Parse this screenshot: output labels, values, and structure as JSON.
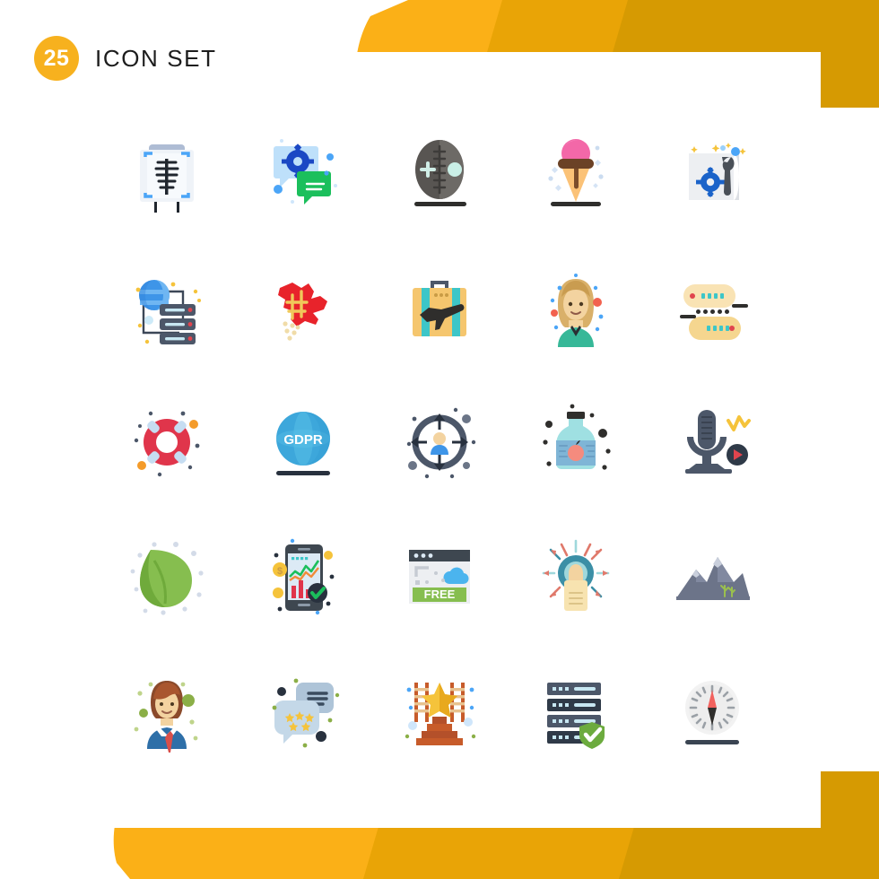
{
  "header": {
    "badge_count": "25",
    "title": "ICON SET"
  },
  "theme": {
    "banner_light": "#FBB017",
    "banner_mid": "#E9A406",
    "banner_dark": "#D69A02",
    "badge_bg": "#F7B11E",
    "panel_bg": "#FFFFFF",
    "title_color": "#1D1D1D"
  },
  "grid": {
    "columns": 5,
    "rows": 5,
    "total": 25
  },
  "icons": [
    {
      "name": "xray-scan-board",
      "label": "X-Ray Scan Board",
      "row": 1,
      "col": 1
    },
    {
      "name": "gear-chat-support",
      "label": "Gear Chat Support",
      "row": 1,
      "col": 2
    },
    {
      "name": "rugby-ball-add",
      "label": "Rugby Ball Add",
      "row": 1,
      "col": 3
    },
    {
      "name": "ice-cream-cone",
      "label": "Ice Cream Cone",
      "row": 1,
      "col": 4
    },
    {
      "name": "blueprint-gear-wrench",
      "label": "Blueprint Gear Wrench",
      "row": 1,
      "col": 5
    },
    {
      "name": "global-server-network",
      "label": "Global Server Network",
      "row": 2,
      "col": 1
    },
    {
      "name": "canada-map",
      "label": "Canada Map",
      "row": 2,
      "col": 2
    },
    {
      "name": "travel-suitcase-flight",
      "label": "Travel Suitcase Flight",
      "row": 2,
      "col": 3
    },
    {
      "name": "woman-avatar",
      "label": "Woman Avatar",
      "row": 2,
      "col": 4
    },
    {
      "name": "data-storage-units",
      "label": "Data Storage Units",
      "row": 2,
      "col": 5
    },
    {
      "name": "lifebuoy-support",
      "label": "Lifebuoy Support",
      "row": 3,
      "col": 1
    },
    {
      "name": "gdpr-globe",
      "label": "GDPR Globe",
      "row": 3,
      "col": 2,
      "text": "GDPR"
    },
    {
      "name": "user-targeting",
      "label": "User Targeting",
      "row": 3,
      "col": 3
    },
    {
      "name": "apple-juice-bottle",
      "label": "Apple Juice Bottle",
      "row": 3,
      "col": 4
    },
    {
      "name": "podcast-microphone",
      "label": "Podcast Microphone",
      "row": 3,
      "col": 5
    },
    {
      "name": "green-leaf",
      "label": "Green Leaf",
      "row": 4,
      "col": 1
    },
    {
      "name": "mobile-finance-chart",
      "label": "Mobile Finance Chart",
      "row": 4,
      "col": 2
    },
    {
      "name": "free-website-banner",
      "label": "Free Website Banner",
      "row": 4,
      "col": 3,
      "text": "FREE"
    },
    {
      "name": "touch-target-finger",
      "label": "Touch Target Finger",
      "row": 4,
      "col": 4
    },
    {
      "name": "mountain-landscape",
      "label": "Mountain Landscape",
      "row": 4,
      "col": 5
    },
    {
      "name": "businessman-avatar",
      "label": "Businessman Avatar",
      "row": 5,
      "col": 1
    },
    {
      "name": "star-review-chat",
      "label": "Star Review Chat",
      "row": 5,
      "col": 2
    },
    {
      "name": "ladder-podium-star",
      "label": "Ladder Podium Star",
      "row": 5,
      "col": 3
    },
    {
      "name": "secure-server-shield",
      "label": "Secure Server Shield",
      "row": 5,
      "col": 4
    },
    {
      "name": "compass-navigation",
      "label": "Compass Navigation",
      "row": 5,
      "col": 5
    }
  ],
  "icon_text": {
    "gdpr": "GDPR",
    "free": "FREE"
  }
}
